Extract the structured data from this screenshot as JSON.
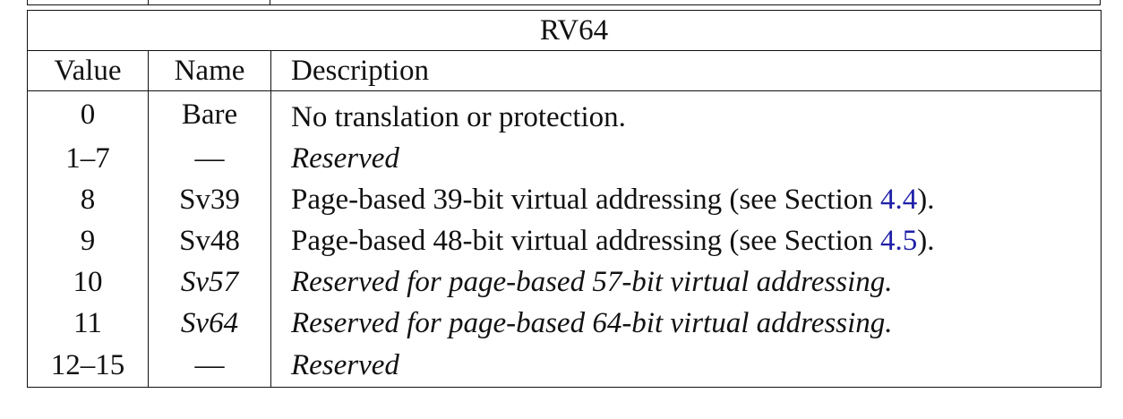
{
  "table": {
    "caption": "RV64",
    "headers": {
      "value": "Value",
      "name": "Name",
      "description": "Description"
    },
    "rows": [
      {
        "value": "0",
        "name": "Bare",
        "description": "No translation or protection.",
        "italic": false
      },
      {
        "value": "1–7",
        "name": "—",
        "description": "Reserved",
        "italic": true
      },
      {
        "value": "8",
        "name": "Sv39",
        "description_prefix": "Page-based 39-bit virtual addressing (see Section ",
        "ref": "4.4",
        "description_suffix": ").",
        "italic": false
      },
      {
        "value": "9",
        "name": "Sv48",
        "description_prefix": "Page-based 48-bit virtual addressing (see Section ",
        "ref": "4.5",
        "description_suffix": ").",
        "italic": false
      },
      {
        "value": "10",
        "name": "Sv57",
        "description": "Reserved for page-based 57-bit virtual addressing.",
        "italic": true
      },
      {
        "value": "11",
        "name": "Sv64",
        "description": "Reserved for page-based 64-bit virtual addressing.",
        "italic": true
      },
      {
        "value": "12–15",
        "name": "—",
        "description": "Reserved",
        "italic": true
      }
    ]
  },
  "colors": {
    "text": "#111111",
    "link": "#1f1fa8",
    "border": "#111111"
  }
}
